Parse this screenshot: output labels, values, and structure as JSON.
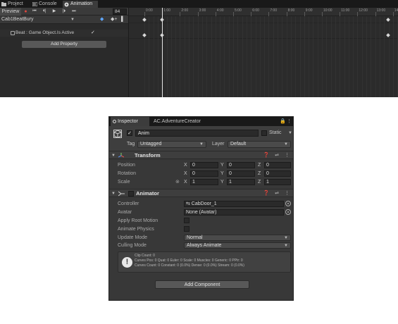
{
  "animation_window": {
    "tabs": [
      {
        "label": "Project",
        "icon": "folder-icon"
      },
      {
        "label": "Console",
        "icon": "console-icon"
      },
      {
        "label": "Animation",
        "icon": "animation-icon",
        "active": true
      }
    ],
    "toolbar": {
      "preview_label": "Preview",
      "record": "●",
      "first_key": "⏮",
      "prev_key": "⏴|",
      "play": "▶",
      "next_key": "|⏵",
      "last_key": "⏭",
      "frame": "84"
    },
    "clip_name": "Cab1BeatBury",
    "clip_tools": {
      "keyframe": "◆",
      "add_key": "◆+",
      "event": "▌"
    },
    "property": {
      "label": "Beat : Game Object.Is Active",
      "checked": "✓"
    },
    "add_property_label": "Add Property",
    "ruler_ticks": [
      "0:00",
      "1:00",
      "2:00",
      "3:00",
      "4:00",
      "5:00",
      "6:00",
      "7:00",
      "8:00",
      "9:00",
      "10:00",
      "11:00",
      "12:00",
      "13:00",
      "14:00"
    ],
    "playhead_time": "1:00"
  },
  "inspector": {
    "tabs": [
      {
        "label": "Inspector"
      },
      {
        "label": "AC.AdventureCreator"
      }
    ],
    "lock_icon": "🔒",
    "menu_icon": "⋮",
    "gameobject": {
      "active_check": "✓",
      "name": "Anim",
      "static_label": "Static",
      "tag_label": "Tag",
      "tag_value": "Untagged",
      "layer_label": "Layer",
      "layer_value": "Default"
    },
    "transform": {
      "title": "Transform",
      "tools": "❓ ⇌ ⋮",
      "position": {
        "label": "Position",
        "x": "0",
        "y": "0",
        "z": "0"
      },
      "rotation": {
        "label": "Rotation",
        "x": "0",
        "y": "0",
        "z": "0"
      },
      "scale": {
        "label": "Scale",
        "x": "1",
        "y": "1",
        "z": "1",
        "link_icon": "⊗"
      }
    },
    "animator": {
      "title": "Animator",
      "tools": "❓ ⇌ ⋮",
      "controller_label": "Controller",
      "controller_value": "⇆ CabDoor_1",
      "avatar_label": "Avatar",
      "avatar_value": "None (Avatar)",
      "apply_root_motion_label": "Apply Root Motion",
      "animate_physics_label": "Animate Physics",
      "update_mode_label": "Update Mode",
      "update_mode_value": "Normal",
      "culling_mode_label": "Culling Mode",
      "culling_mode_value": "Always Animate",
      "info": {
        "icon": "!",
        "line1": "Clip Count: 0",
        "line2": "Curves Pos: 0 Quat: 0 Euler: 0 Scale: 0 Muscles: 0 Generic: 0 PPtr: 0",
        "line3": "Curves Count: 0 Constant: 0 (0.0%) Dense: 0 (0.0%) Stream: 0 (0.0%)"
      }
    },
    "add_component_label": "Add Component"
  },
  "colors": {
    "panel_bg": "#383838",
    "timeline_bg": "#2b2b2b",
    "record": "#e0473f",
    "accent_blue": "#5fa8ff"
  }
}
